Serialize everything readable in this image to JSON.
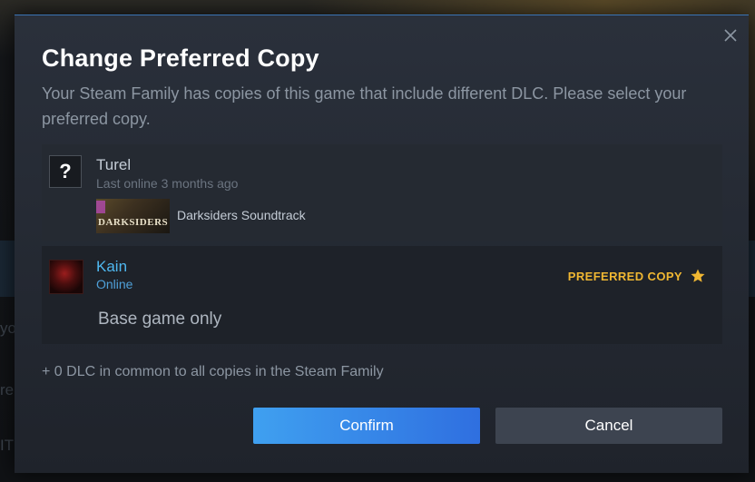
{
  "dialog": {
    "title": "Change Preferred Copy",
    "subtitle": "Your Steam Family has copies of this game that include different DLC. Please select your preferred copy.",
    "close_icon": "close-icon"
  },
  "copies": [
    {
      "user_name": "Turel",
      "status": "Last online 3 months ago",
      "avatar_glyph": "?",
      "dlc": [
        {
          "thumb_text": "DARKSIDERS",
          "name": "Darksiders Soundtrack"
        }
      ]
    },
    {
      "user_name": "Kain",
      "status": "Online",
      "preferred_label": "PREFERRED COPY",
      "base_text": "Base game only"
    }
  ],
  "footer": {
    "dlc_common": "+ 0 DLC in common to all copies in the Steam Family",
    "confirm_label": "Confirm",
    "cancel_label": "Cancel"
  },
  "background": {
    "ghost_texts": [
      "yo",
      "re",
      "IT"
    ]
  },
  "colors": {
    "accent_blue": "#3fa0f0",
    "online_blue": "#4fb8f0",
    "preferred_gold": "#f0b732"
  }
}
